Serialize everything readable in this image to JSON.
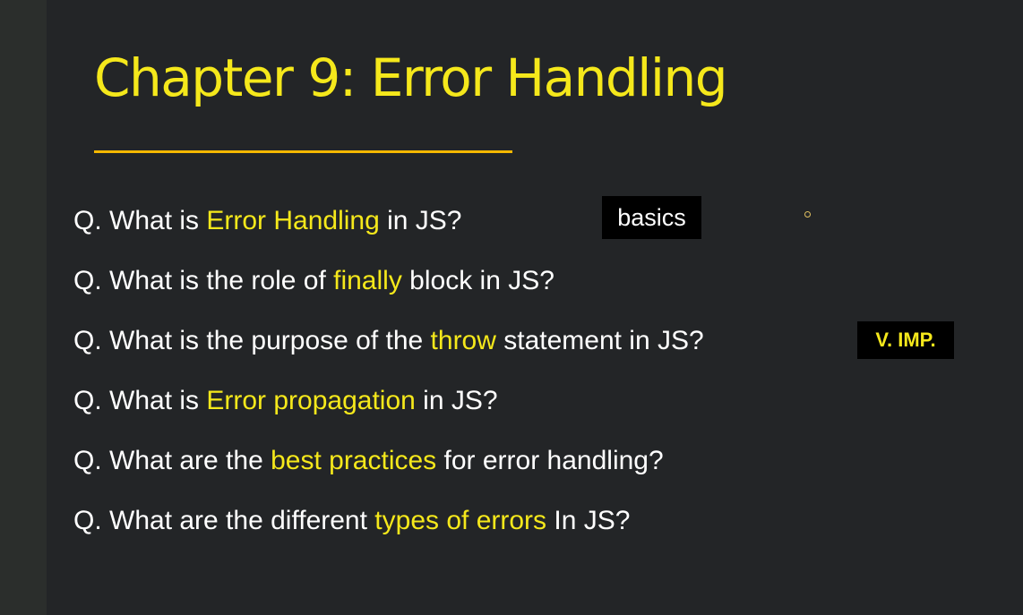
{
  "slide": {
    "title": "Chapter 9: Error Handling",
    "questions": [
      {
        "prefix": "Q. What is ",
        "highlight": "Error Handling",
        "suffix": " in JS?"
      },
      {
        "prefix": "Q. What is the role of ",
        "highlight": "finally",
        "suffix": " block in JS?"
      },
      {
        "prefix": "Q. What is the purpose of the ",
        "highlight": "throw",
        "suffix": " statement in JS?"
      },
      {
        "prefix": "Q. What is ",
        "highlight": "Error propagation",
        "suffix": " in JS?"
      },
      {
        "prefix": "Q. What are the ",
        "highlight": "best practices",
        "suffix": " for error handling?"
      },
      {
        "prefix": "Q. What are the different ",
        "highlight": "types of errors",
        "suffix": " In JS?"
      }
    ],
    "tags": {
      "basics": "basics",
      "very_important": "V. IMP."
    }
  },
  "colors": {
    "background": "#232527",
    "accent": "#f5e81b",
    "underline": "#f5b800",
    "text": "#ffffff"
  }
}
